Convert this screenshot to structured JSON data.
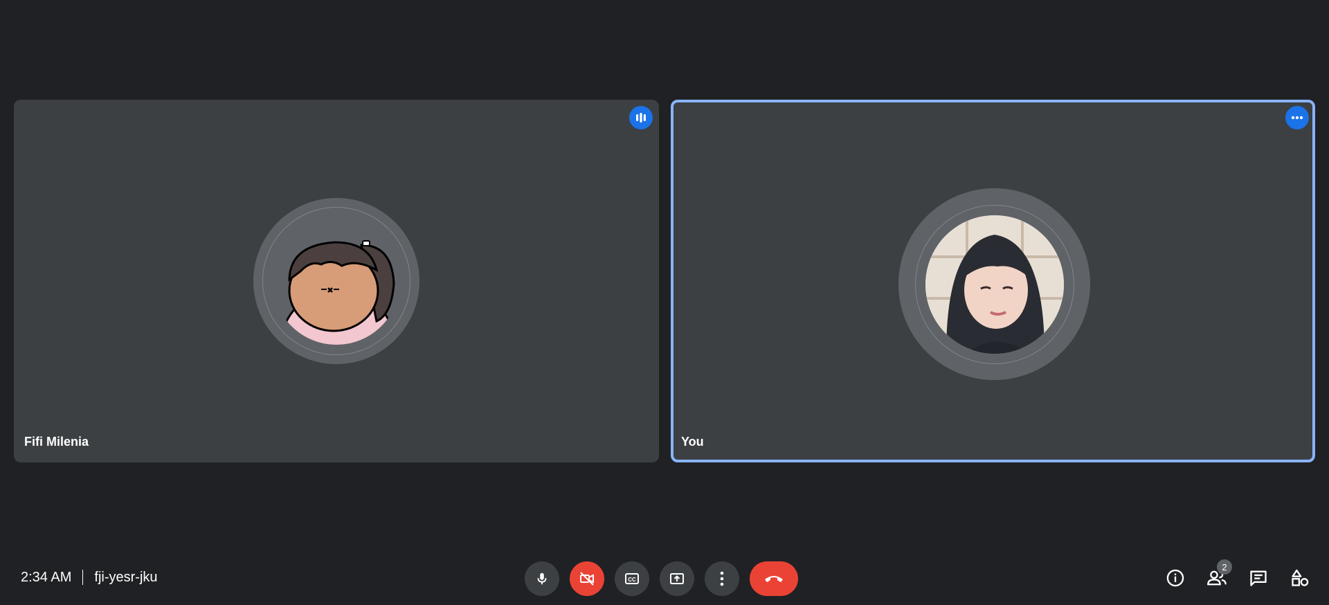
{
  "participants": [
    {
      "name": "Fifi Milenia",
      "status_icon": "audio-level-icon",
      "avatar": "cartoon-girl-ponytail"
    },
    {
      "name": "You",
      "status_icon": "more-options-icon",
      "avatar": "profile-photo",
      "active": true
    }
  ],
  "meeting": {
    "time": "2:34 AM",
    "code": "fji-yesr-jku"
  },
  "controls": [
    {
      "name": "microphone",
      "icon": "mic-icon"
    },
    {
      "name": "camera",
      "icon": "camera-off-icon",
      "state": "off"
    },
    {
      "name": "captions",
      "icon": "cc-icon"
    },
    {
      "name": "present",
      "icon": "present-screen-icon"
    },
    {
      "name": "more-options",
      "icon": "more-vert-icon"
    },
    {
      "name": "leave-call",
      "icon": "hang-up-icon"
    }
  ],
  "right_tools": {
    "people_count": "2",
    "items": [
      "info-icon",
      "people-icon",
      "chat-icon",
      "activities-icon"
    ]
  },
  "colors": {
    "background": "#202124",
    "tile": "#3c4043",
    "accent": "#1a73e8",
    "active_border": "#8ab4f8",
    "danger": "#ea4335"
  }
}
